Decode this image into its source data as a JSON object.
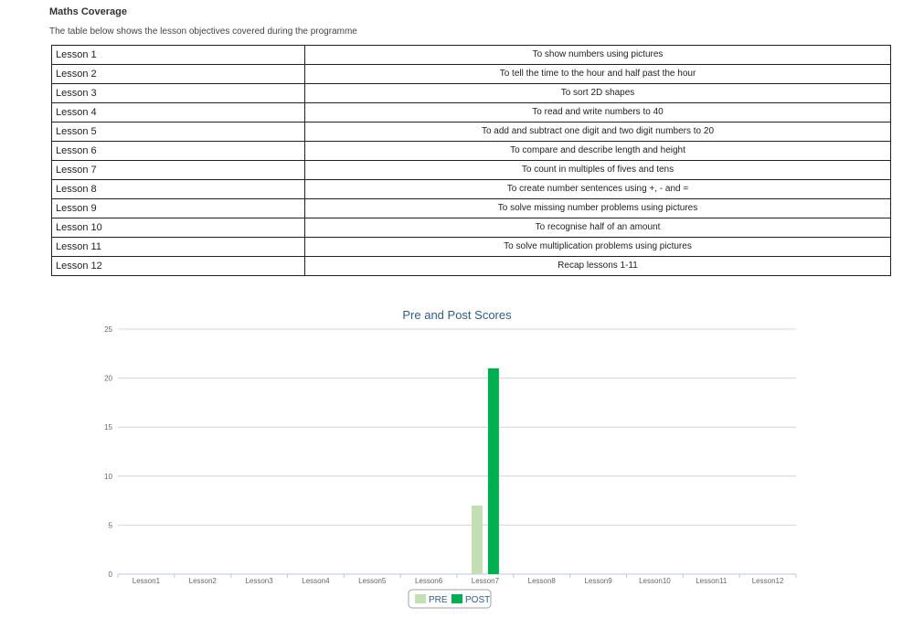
{
  "heading": "Maths Coverage",
  "intro": "The table below shows the lesson objectives covered during the programme",
  "lessons": [
    {
      "lesson": "Lesson 1",
      "objective": "To show numbers using pictures"
    },
    {
      "lesson": "Lesson 2",
      "objective": "To tell the time to the hour and half past the hour"
    },
    {
      "lesson": "Lesson 3",
      "objective": "To sort 2D shapes"
    },
    {
      "lesson": "Lesson 4",
      "objective": "To read and write numbers to 40"
    },
    {
      "lesson": "Lesson 5",
      "objective": "To add and subtract one digit and two digit numbers to 20"
    },
    {
      "lesson": "Lesson 6",
      "objective": "To compare and describe length and height"
    },
    {
      "lesson": "Lesson 7",
      "objective": "To count in multiples of fives and tens"
    },
    {
      "lesson": "Lesson 8",
      "objective": "To create number sentences using +, - and ="
    },
    {
      "lesson": "Lesson 9",
      "objective": "To solve missing number problems using pictures"
    },
    {
      "lesson": "Lesson 10",
      "objective": "To recognise half of an amount"
    },
    {
      "lesson": "Lesson 11",
      "objective": "To solve multiplication problems using pictures"
    },
    {
      "lesson": "Lesson 12",
      "objective": "Recap lessons 1-11"
    }
  ],
  "chart_data": {
    "type": "bar",
    "title": "Pre and Post Scores",
    "xlabel": "",
    "ylabel": "",
    "categories": [
      "Lesson1",
      "Lesson2",
      "Lesson3",
      "Lesson4",
      "Lesson5",
      "Lesson6",
      "Lesson7",
      "Lesson8",
      "Lesson9",
      "Lesson10",
      "Lesson11",
      "Lesson12"
    ],
    "series": [
      {
        "name": "PRE",
        "color": "#c2e0b4",
        "values": [
          0,
          0,
          0,
          0,
          0,
          0,
          7,
          0,
          0,
          0,
          0,
          0
        ]
      },
      {
        "name": "POST",
        "color": "#00b050",
        "values": [
          0,
          0,
          0,
          0,
          0,
          0,
          21,
          0,
          0,
          0,
          0,
          0
        ]
      }
    ],
    "ylim": [
      0,
      25
    ],
    "yticks": [
      0,
      5,
      10,
      15,
      20,
      25
    ],
    "grid": true,
    "legend_position": "bottom",
    "title_color": "#2f5d8a"
  }
}
